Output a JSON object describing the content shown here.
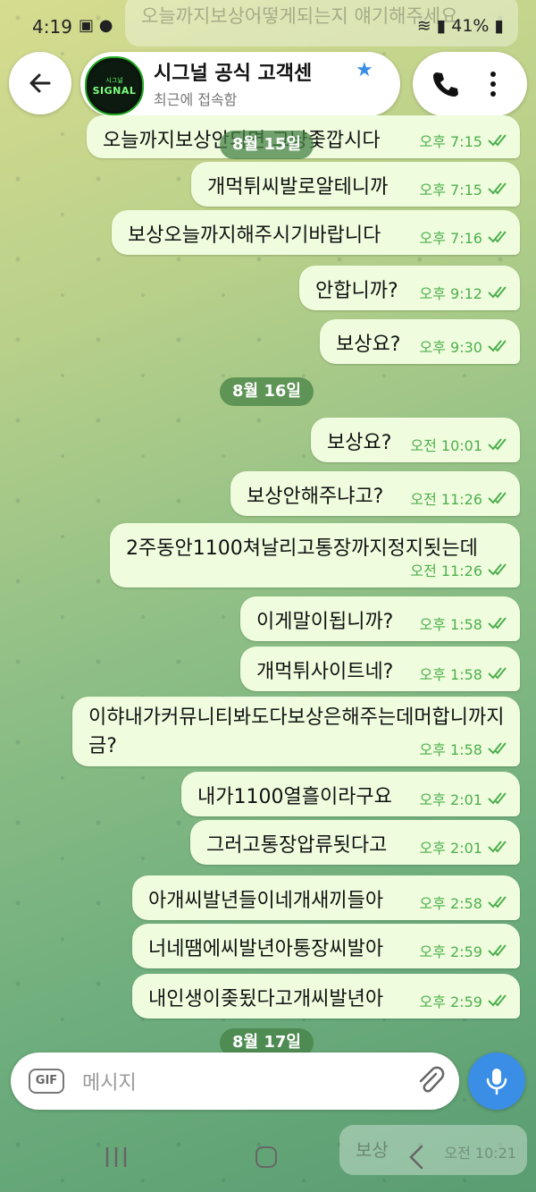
{
  "status_bar": {
    "time": "4:19",
    "battery": "41%"
  },
  "header": {
    "avatar_small": "시그널",
    "avatar_big": "SIGNAL",
    "chat_name": "시그널 공식 고객센",
    "chat_status": "최근에 접속함"
  },
  "ghost_top": "오늘까지보상어떻게되는지 얘기해주세요",
  "dates": {
    "d15": "8월 15일",
    "d16": "8월 16일",
    "d17": "8월 17일"
  },
  "messages": [
    {
      "text": "오늘까지보상안되면 그냥좇깝시다",
      "time": "오후 7:15"
    },
    {
      "text": "개먹튀씨발로알테니까",
      "time": "오후 7:15"
    },
    {
      "text": "보상오늘까지해주시기바랍니다",
      "time": "오후 7:16"
    },
    {
      "text": "안합니까?",
      "time": "오후 9:12"
    },
    {
      "text": "보상요?",
      "time": "오후 9:30"
    },
    {
      "text": "보상요?",
      "time": "오전 10:01"
    },
    {
      "text": "보상안해주냐고?",
      "time": "오전 11:26"
    },
    {
      "text": "2주동안1100쳐날리고통장까지정지됫는데",
      "time": "오전 11:26"
    },
    {
      "text": "이게말이됩니까?",
      "time": "오후 1:58"
    },
    {
      "text": "개먹튀사이트네?",
      "time": "오후 1:58"
    },
    {
      "text": "이햐내가커뮤니티봐도다보상은해주는데머합니까지금?",
      "time": "오후 1:58"
    },
    {
      "text": "내가1100열흘이라구요",
      "time": "오후 2:01"
    },
    {
      "text": "그러고통장압류됫다고",
      "time": "오후 2:01"
    },
    {
      "text": "아개씨발년들이네개새끼들아",
      "time": "오후 2:58"
    },
    {
      "text": "너네땜에씨발년아통장씨발아",
      "time": "오후 2:59"
    },
    {
      "text": "내인생이좆됬다고개씨발년아",
      "time": "오후 2:59"
    }
  ],
  "input": {
    "placeholder": "메시지",
    "gif_label": "GIF"
  },
  "ghost_bottom": {
    "text": "보상",
    "time": "오전 10:21"
  }
}
